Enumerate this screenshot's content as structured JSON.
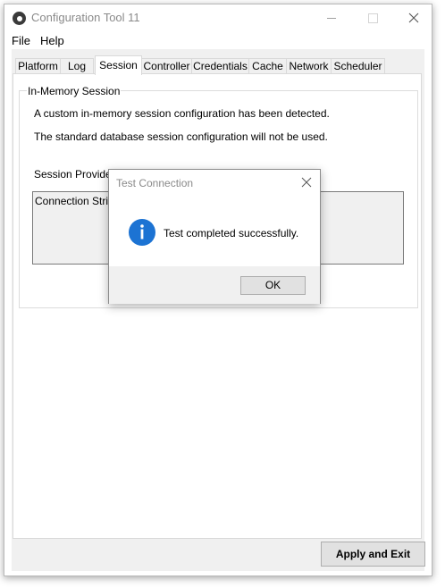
{
  "window": {
    "title": "Configuration Tool 11",
    "icon": "circle-ring-icon"
  },
  "menu": {
    "items": [
      {
        "label": "File"
      },
      {
        "label": "Help"
      }
    ]
  },
  "tabs": [
    {
      "label": "Platform"
    },
    {
      "label": "Log"
    },
    {
      "label": "Session",
      "active": true
    },
    {
      "label": "Controller"
    },
    {
      "label": "Credentials"
    },
    {
      "label": "Cache"
    },
    {
      "label": "Network"
    },
    {
      "label": "Scheduler"
    }
  ],
  "session": {
    "group_title": "In-Memory Session",
    "line1": "A custom in-memory session configuration has been detected.",
    "line2": "The standard database session configuration will not be used.",
    "provider": "Session Provider: Redis",
    "connection_label": "Connection String"
  },
  "footer": {
    "apply_label": "Apply and Exit"
  },
  "dialog": {
    "title": "Test Connection",
    "message": "Test completed successfully.",
    "ok_label": "OK",
    "icon": "info-icon",
    "icon_color": "#1c73d3"
  }
}
